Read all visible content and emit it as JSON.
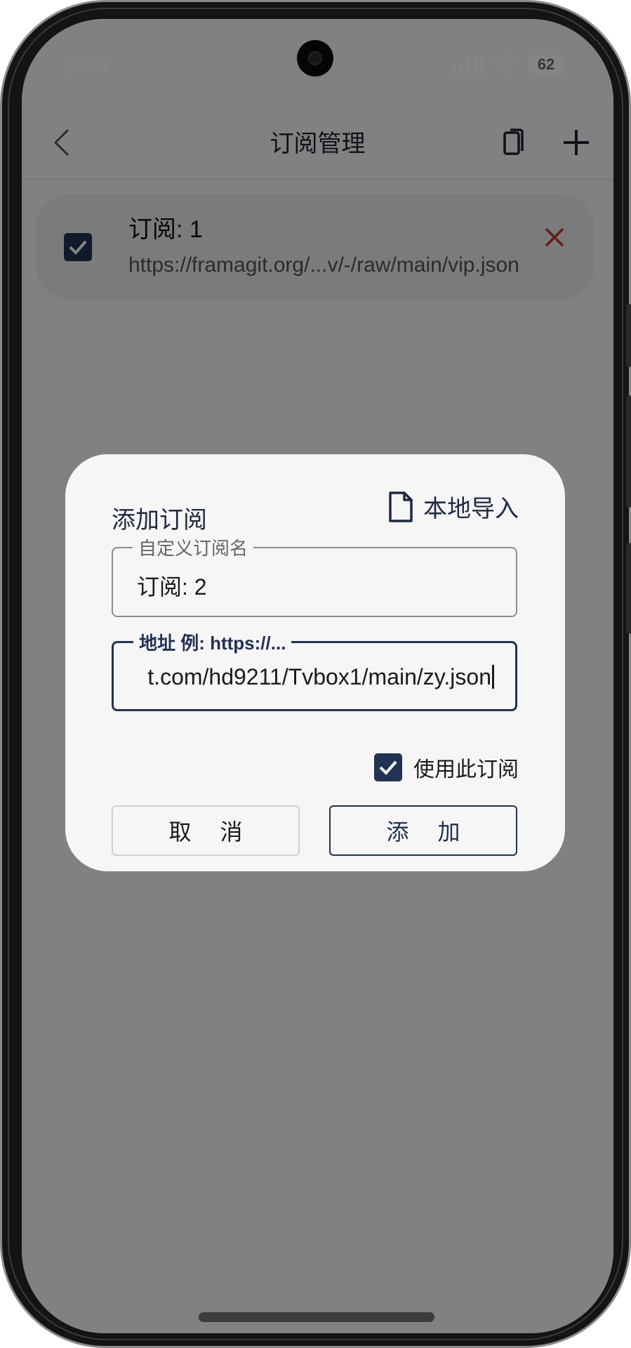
{
  "status_bar": {
    "time": "5:47",
    "battery": "62"
  },
  "app_bar": {
    "title": "订阅管理"
  },
  "subscription": {
    "name": "订阅: 1",
    "url": "https://framagit.org/...v/-/raw/main/vip.json",
    "checked": true
  },
  "dialog": {
    "title": "添加订阅",
    "import_label": "本地导入",
    "name_field": {
      "label": "自定义订阅名",
      "value": "订阅: 2"
    },
    "url_field": {
      "label": "地址 例: https://...",
      "value": "t.com/hd9211/Tvbox1/main/zy.json"
    },
    "use_checkbox": {
      "label": "使用此订阅",
      "checked": true
    },
    "cancel_label": "取 消",
    "add_label": "添 加"
  },
  "colors": {
    "accent": "#213252",
    "delete": "#c0392b",
    "scrim": "rgba(0,0,0,0.48)"
  }
}
